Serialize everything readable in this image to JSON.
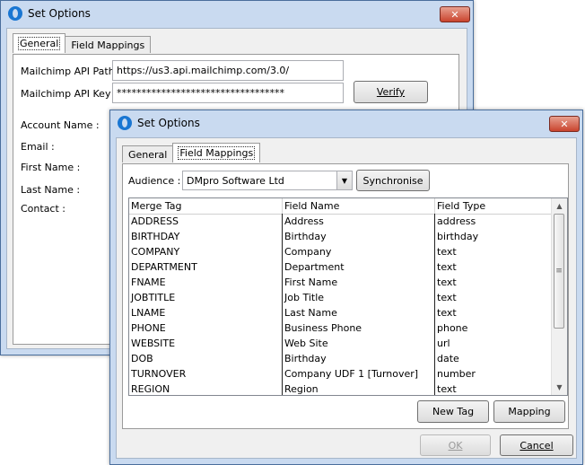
{
  "back_window": {
    "title": "Set Options",
    "close_glyph": "✕",
    "tabs": [
      {
        "label": "General",
        "active": true
      },
      {
        "label": "Field Mappings",
        "active": false
      }
    ],
    "api_path_label": "Mailchimp API Path :",
    "api_path_value": "https://us3.api.mailchimp.com/3.0/",
    "api_key_label": "Mailchimp API Key :",
    "api_key_value": "**********************************",
    "verify_label": "Verify",
    "account_name_label": "Account Name :",
    "email_label": "Email :",
    "first_name_label": "First Name :",
    "last_name_label": "Last  Name :",
    "contact_label": "Contact :"
  },
  "front_window": {
    "title": "Set Options",
    "close_glyph": "✕",
    "tabs": [
      {
        "label": "General",
        "active": false
      },
      {
        "label": "Field Mappings",
        "active": true
      }
    ],
    "audience_label": "Audience :",
    "audience_value": "DMpro Software Ltd",
    "synchronise_label": "Synchronise",
    "columns": [
      "Merge Tag",
      "Field Name",
      "Field Type"
    ],
    "rows": [
      [
        "ADDRESS",
        "Address",
        "address"
      ],
      [
        "BIRTHDAY",
        "Birthday",
        "birthday"
      ],
      [
        "COMPANY",
        "Company",
        "text"
      ],
      [
        "DEPARTMENT",
        "Department",
        "text"
      ],
      [
        "FNAME",
        "First Name",
        "text"
      ],
      [
        "JOBTITLE",
        "Job Title",
        "text"
      ],
      [
        "LNAME",
        "Last Name",
        "text"
      ],
      [
        "PHONE",
        "Business Phone",
        "phone"
      ],
      [
        "WEBSITE",
        "Web Site",
        "url"
      ],
      [
        "DOB",
        "Birthday",
        "date"
      ],
      [
        "TURNOVER",
        "Company UDF 1 [Turnover]",
        "number"
      ],
      [
        "REGION",
        "Region",
        "text"
      ]
    ],
    "new_tag_label": "New Tag",
    "mapping_label": "Mapping",
    "ok_label": "OK",
    "cancel_label": "Cancel"
  },
  "colors": {
    "frame": "#c9daf0",
    "close": "#c9442e",
    "app_icon": "#1976d2"
  }
}
